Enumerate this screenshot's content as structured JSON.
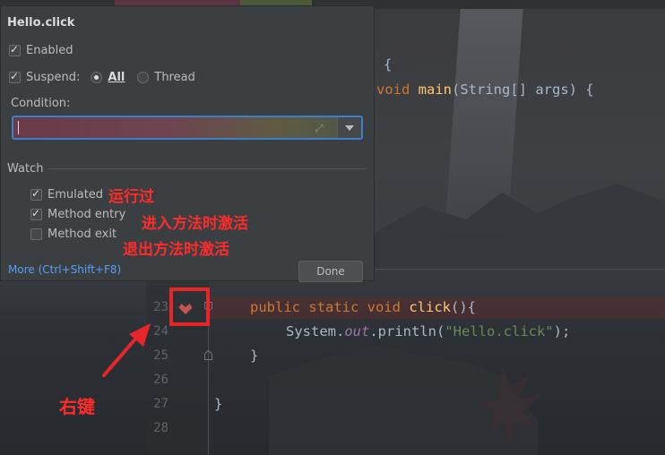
{
  "popup": {
    "title": "Hello.click",
    "enabled_label": "Enabled",
    "enabled_checked": true,
    "suspend_label": "Suspend:",
    "suspend_checked": true,
    "suspend_all_label": "All",
    "suspend_thread_label": "Thread",
    "suspend_selected": "All",
    "condition_label": "Condition:",
    "condition_value": "",
    "watch_label": "Watch",
    "watch_items": [
      {
        "label": "Emulated",
        "checked": true
      },
      {
        "label": "Method entry",
        "checked": true
      },
      {
        "label": "Method exit",
        "checked": false
      }
    ],
    "more_link": "More (Ctrl+Shift+F8)",
    "done_label": "Done"
  },
  "editor": {
    "line_numbers": [
      "23",
      "24",
      "25",
      "26",
      "27",
      "28"
    ],
    "upper_code": {
      "brace": "{",
      "main_kw": "void",
      "main_name": "main",
      "main_params": "(String[] args) {"
    },
    "lines": {
      "l23_kw": "public static void",
      "l23_name": "click",
      "l23_rest": "(){",
      "l24_pre": "System.",
      "l24_field": "out",
      "l24_mid": ".println(",
      "l24_str": "\"Hello.click\"",
      "l24_end": ");",
      "l25": "}",
      "l27": "}"
    }
  },
  "annotations": {
    "emulated_note": "运行过",
    "entry_note": "进入方法时激活",
    "exit_note": "退出方法时激活",
    "right_click_note": "右键",
    "color": "#ff2b2b"
  },
  "icons": {
    "breakpoint": "breakpoint-icon",
    "fold": "fold-icon",
    "expand": "expand-icon",
    "dropdown": "chevron-down-icon"
  }
}
